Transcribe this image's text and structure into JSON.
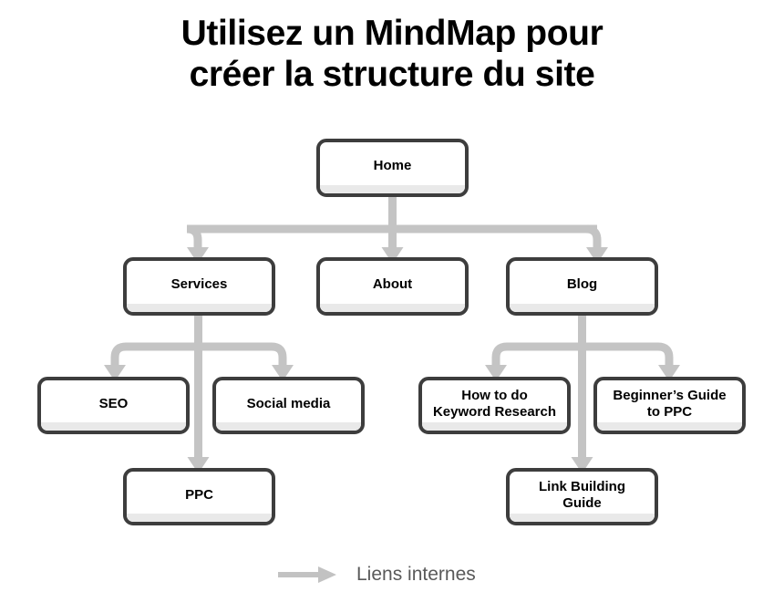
{
  "title": "Utilisez un MindMap pour\ncréer la structure du site",
  "accent_colors": {
    "box_border": "#3d3d3d",
    "box_fill": "#ffffff",
    "box_inner_shade": "#e9e9e9",
    "connector": "#c4c4c4",
    "legend_text": "#595959",
    "title_text": "#000000",
    "background": "#ffffff"
  },
  "nodes": {
    "home": {
      "label": "Home"
    },
    "services": {
      "label": "Services"
    },
    "about": {
      "label": "About"
    },
    "blog": {
      "label": "Blog"
    },
    "seo": {
      "label": "SEO"
    },
    "social_media": {
      "label": "Social media"
    },
    "ppc": {
      "label": "PPC"
    },
    "keyword_research": {
      "label": "How to do\nKeyword Research"
    },
    "beginners_guide_ppc": {
      "label": "Beginner’s Guide\nto PPC"
    },
    "link_building_guide": {
      "label": "Link Building\nGuide"
    }
  },
  "legend": {
    "arrow_icon": "right-arrow-icon",
    "label": "Liens internes"
  },
  "edges": [
    {
      "from": "home",
      "to": "services"
    },
    {
      "from": "home",
      "to": "about"
    },
    {
      "from": "home",
      "to": "blog"
    },
    {
      "from": "services",
      "to": "seo"
    },
    {
      "from": "services",
      "to": "social_media"
    },
    {
      "from": "services",
      "to": "ppc"
    },
    {
      "from": "blog",
      "to": "keyword_research"
    },
    {
      "from": "blog",
      "to": "beginners_guide_ppc"
    },
    {
      "from": "blog",
      "to": "link_building_guide"
    }
  ]
}
